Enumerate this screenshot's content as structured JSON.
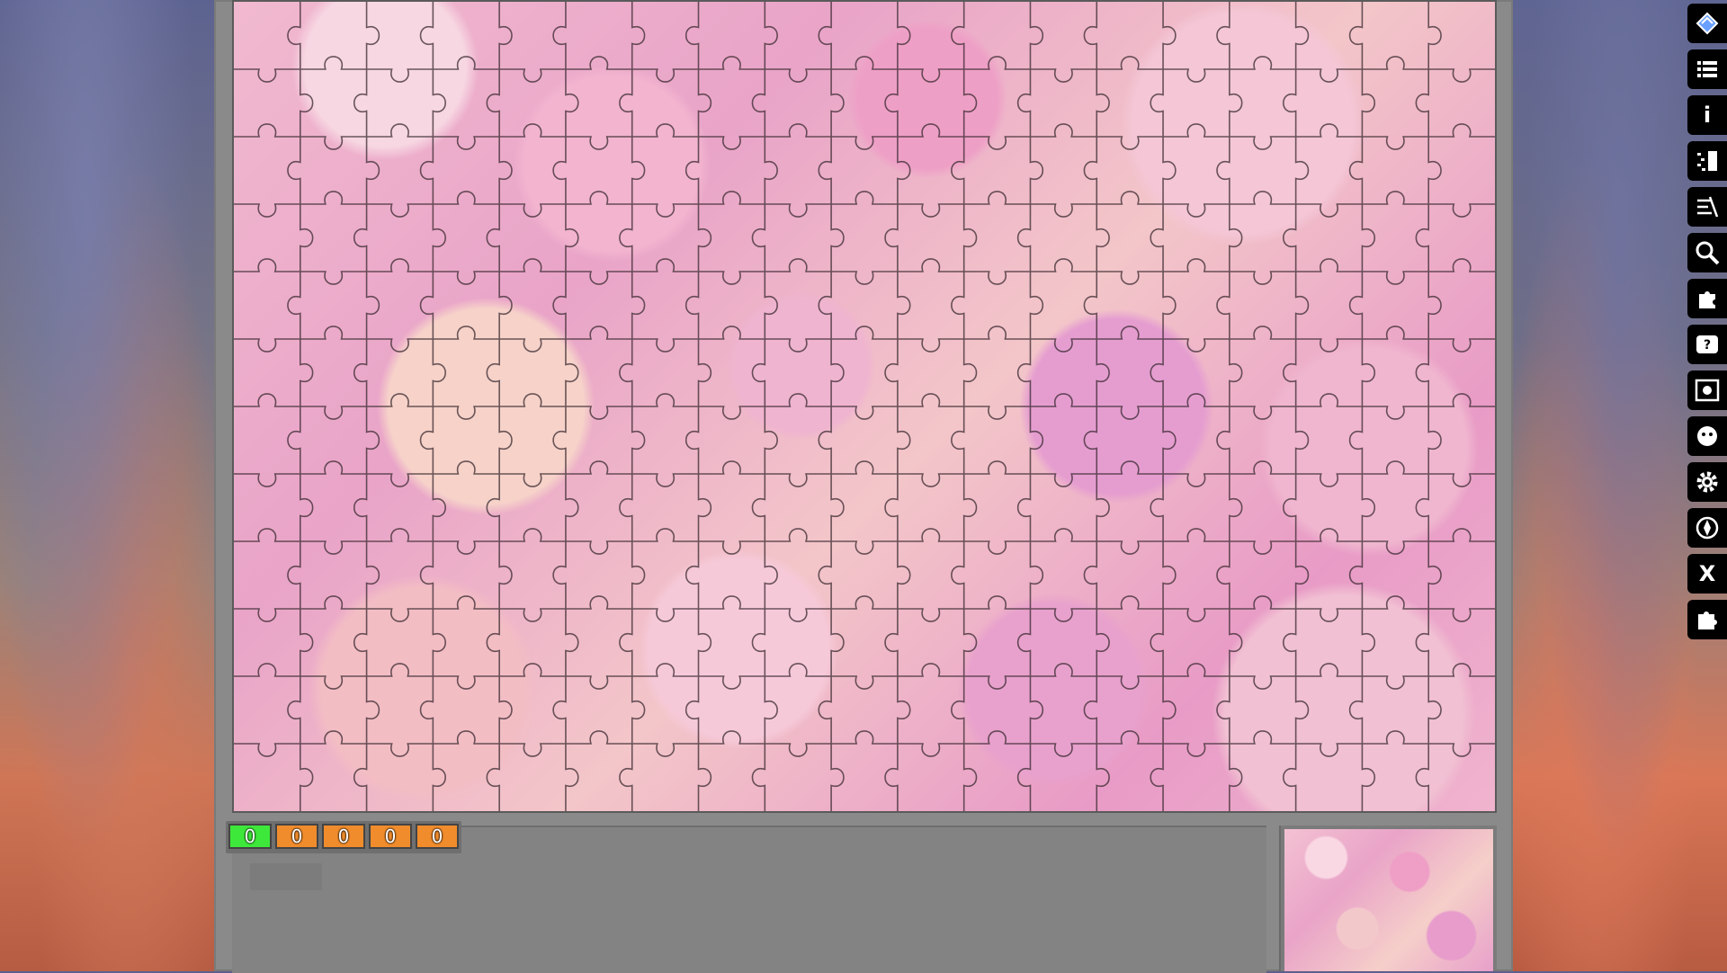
{
  "counters": [
    {
      "value": "0",
      "color": "#3ee83a"
    },
    {
      "value": "0",
      "color": "#f08c2c"
    },
    {
      "value": "0",
      "color": "#f08c2c"
    },
    {
      "value": "0",
      "color": "#f08c2c"
    },
    {
      "value": "0",
      "color": "#f08c2c"
    }
  ],
  "toolbar": {
    "info_label": "i",
    "close_label": "X"
  },
  "colors": {
    "frame": "#8a8a8a",
    "counter_green": "#3ee83a",
    "counter_orange": "#f08c2c",
    "toolbar_bg": "#000000"
  },
  "icons": [
    "game-logo-icon",
    "menu-list-icon",
    "info-icon",
    "scatter-pieces-icon",
    "shuffle-icon",
    "magnifier-icon",
    "puzzle-edge-icon",
    "help-icon",
    "screenshot-icon",
    "puzzle-face-icon",
    "settings-gear-icon",
    "compass-icon",
    "close-icon",
    "puzzle-piece-icon"
  ]
}
